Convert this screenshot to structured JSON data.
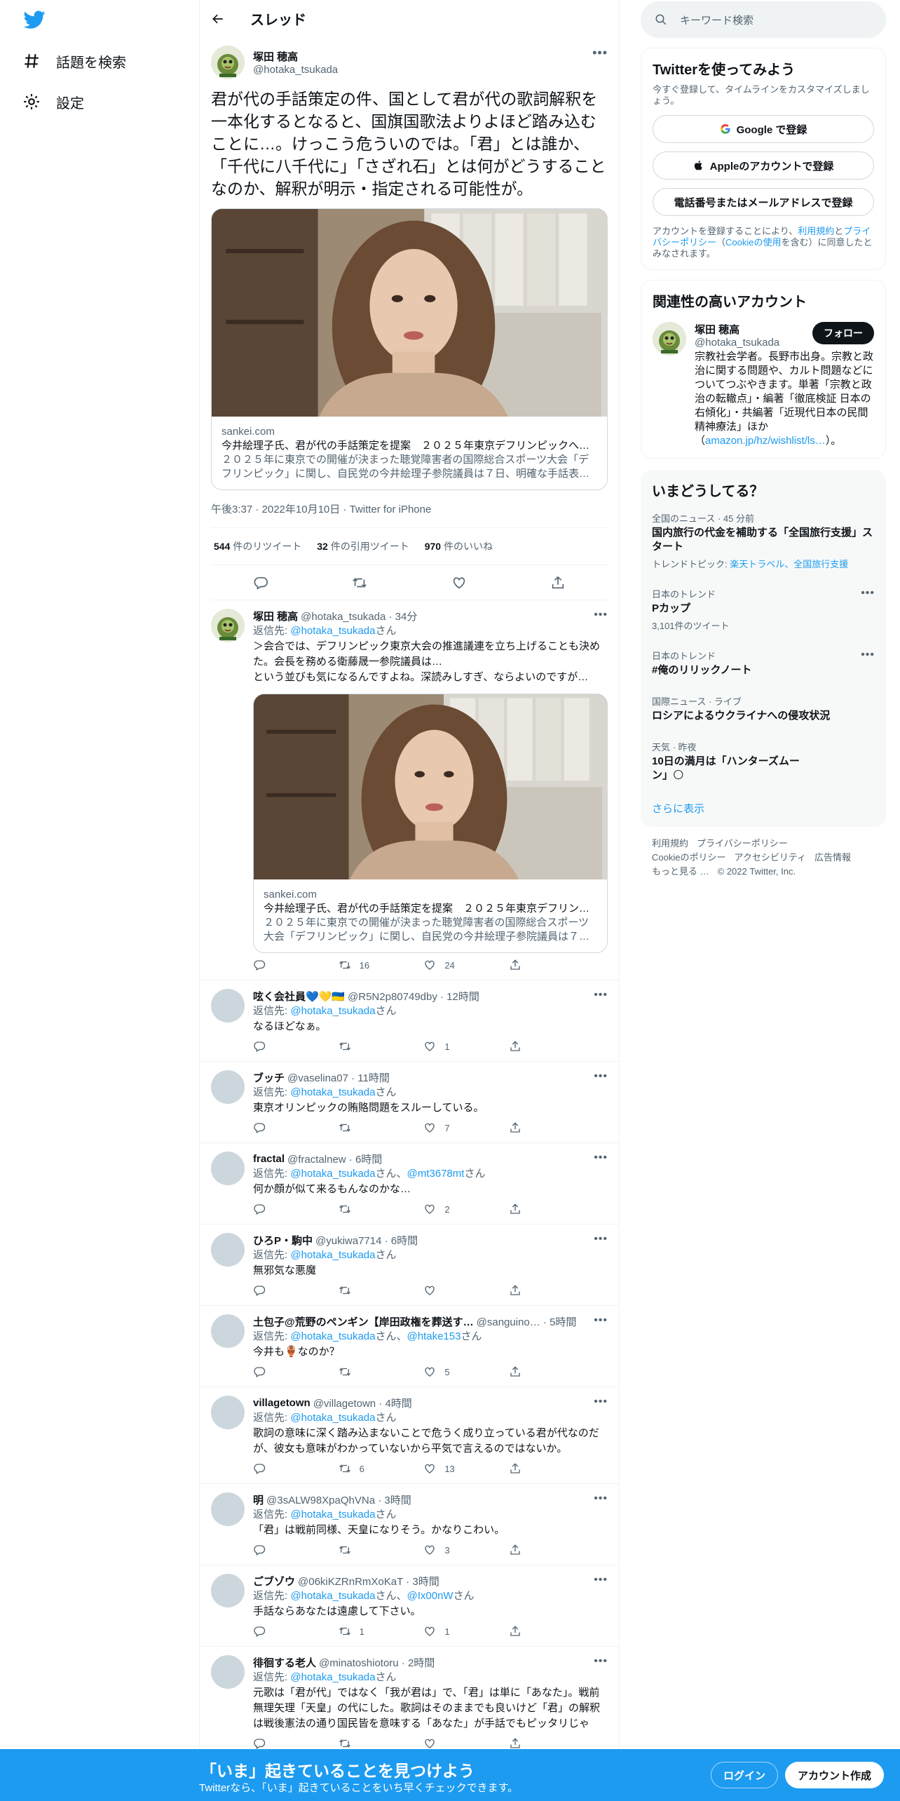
{
  "nav": {
    "explore": "話題を検索",
    "settings": "設定"
  },
  "thread": {
    "title": "スレッド"
  },
  "main_tweet": {
    "name": "塚田 穂高",
    "handle": "@hotaka_tsukada",
    "text": "君が代の手話策定の件、国として君が代の歌詞解釈を一本化するとなると、国旗国歌法よりよほど踏み込むことに…。けっこう危ういのでは。「君」とは誰か、「千代に八千代に」「さざれ石」とは何がどうすることなのか、解釈が明示・指定される可能性が。",
    "card": {
      "domain": "sankei.com",
      "title": "今井絵理子氏、君が代の手話策定を提案　２０２５年東京デフリンピックへ議…",
      "desc": "２０２５年に東京での開催が決まった聴覚障害者の国際総合スポーツ大会「デフリンピック」に関し、自民党の今井絵理子参院議員は７日、明確な手話表現が…"
    },
    "meta": "午後3:37 · 2022年10月10日 · Twitter for iPhone",
    "retweets": "544",
    "retweets_label": "件のリツイート",
    "quotes": "32",
    "quotes_label": "件の引用ツイート",
    "likes": "970",
    "likes_label": "件のいいね"
  },
  "reply_prefix": "返信先: ",
  "replies": [
    {
      "name": "塚田 穂高",
      "handle": "@hotaka_tsukada · 34分",
      "to": "@hotaka_tsukada",
      "to_suffix": "さん",
      "text": "＞会合では、デフリンピック東京大会の推進議連を立ち上げることも決めた。会長を務める衛藤晟一参院議員は…\nという並びも気になるんですよね。深読みしすぎ、ならよいのですが…",
      "card": {
        "domain": "sankei.com",
        "title": "今井絵理子氏、君が代の手話策定を提案　２０２５年東京デフリンピ…",
        "desc": "２０２５年に東京での開催が決まった聴覚障害者の国際総合スポーツ大会「デフリンピック」に関し、自民党の今井絵理子参院議員は７日、…"
      },
      "replies": "",
      "rts": "16",
      "likes": "24"
    },
    {
      "name": "呟く会社員💙💛🇺🇦",
      "handle": "@R5N2p80749dby · 12時間",
      "to": "@hotaka_tsukada",
      "to_suffix": "さん",
      "text": "なるほどなぁ。",
      "replies": "",
      "rts": "",
      "likes": "1"
    },
    {
      "name": "ブッチ",
      "handle": "@vaselina07 · 11時間",
      "to": "@hotaka_tsukada",
      "to_suffix": "さん",
      "text": "東京オリンピックの賄賂問題をスルーしている。",
      "replies": "",
      "rts": "",
      "likes": "7"
    },
    {
      "name": "fractal",
      "handle": "@fractalnew · 6時間",
      "to": "@hotaka_tsukada",
      "to_mid": "さん、",
      "to2": "@mt3678mt",
      "to_suffix": "さん",
      "text": "何か顔が似て来るもんなのかな…",
      "replies": "",
      "rts": "",
      "likes": "2"
    },
    {
      "name": "ひろP・駒中",
      "handle": "@yukiwa7714 · 6時間",
      "to": "@hotaka_tsukada",
      "to_suffix": "さん",
      "text": "無邪気な悪魔",
      "replies": "",
      "rts": "",
      "likes": ""
    },
    {
      "name": "土包子@荒野のペンギン【岸田政権を葬送す…",
      "handle": "@sanguino… · 5時間",
      "to": "@hotaka_tsukada",
      "to_mid": "さん、",
      "to2": "@htake153",
      "to_suffix": "さん",
      "text": "今井も🏺なのか？",
      "replies": "",
      "rts": "",
      "likes": "5"
    },
    {
      "name": "villagetown",
      "handle": "@villagetown · 4時間",
      "to": "@hotaka_tsukada",
      "to_suffix": "さん",
      "text": "歌詞の意味に深く踏み込まないことで危うく成り立っている君が代なのだが、彼女も意味がわかっていないから平気で言えるのではないか。",
      "replies": "",
      "rts": "6",
      "likes": "13"
    },
    {
      "name": "明",
      "handle": "@3sALW98XpaQhVNa · 3時間",
      "to": "@hotaka_tsukada",
      "to_suffix": "さん",
      "text": "「君」は戦前同様、天皇になりそう。かなりこわい。",
      "replies": "",
      "rts": "",
      "likes": "3"
    },
    {
      "name": "ごブゾウ",
      "handle": "@06kiKZRnRmXoKaT · 3時間",
      "to": "@hotaka_tsukada",
      "to_mid": "さん、",
      "to2": "@Ix00nW",
      "to_suffix": "さん",
      "text": "手話ならあなたは遠慮して下さい。",
      "replies": "",
      "rts": "1",
      "likes": "1"
    },
    {
      "name": "徘徊する老人",
      "handle": "@minatoshiotoru · 2時間",
      "to": "@hotaka_tsukada",
      "to_suffix": "さん",
      "text": "元歌は「君が代」ではなく「我が君は」で、「君」は単に「あなた」。戦前無理矢理「天皇」の代にした。歌詞はそのままでも良いけど「君」の解釈は戦後憲法の通り国民皆を意味する「あなた」が手話でもピッタリじゃ",
      "replies": "",
      "rts": "",
      "likes": ""
    }
  ],
  "search": {
    "placeholder": "キーワード検索"
  },
  "signup": {
    "title": "Twitterを使ってみよう",
    "sub": "今すぐ登録して、タイムラインをカスタマイズしましょう。",
    "google": "Google で登録",
    "apple": "Appleのアカウントで登録",
    "phone": "電話番号またはメールアドレスで登録",
    "terms_1": "アカウントを登録することにより、",
    "terms_link1": "利用規約",
    "terms_2": "と",
    "terms_link2": "プライバシーポリシー",
    "terms_3": "（",
    "terms_link3": "Cookieの使用",
    "terms_4": "を含む）に同意したとみなされます。"
  },
  "relevant": {
    "title": "関連性の高いアカウント",
    "name": "塚田 穂高",
    "handle": "@hotaka_tsukada",
    "follow": "フォロー",
    "bio": "宗教社会学者。長野市出身。宗教と政治に関する問題や、カルト問題などについてつぶやきます。単著「宗教と政治の転轍点」・編著「徹底検証 日本の右傾化」・共編著「近現代日本の民間精神療法」ほか（",
    "bio_link": "amazon.jp/hz/wishlist/ls…",
    "bio_end": "）。"
  },
  "trends": {
    "title": "いまどうしてる？",
    "items": [
      {
        "meta": "全国のニュース · 45 分前",
        "title": "国内旅行の代金を補助する「全国旅行支援」スタート",
        "sub_prefix": "トレンドトピック: ",
        "sub_links": "楽天トラベル、全国旅行支援"
      },
      {
        "meta": "日本のトレンド",
        "title": "Pカップ",
        "sub": "3,101件のツイート"
      },
      {
        "meta": "日本のトレンド",
        "title": "#俺のリリックノート"
      },
      {
        "meta": "国際ニュース · ライブ",
        "title": "ロシアによるウクライナへの侵攻状況"
      },
      {
        "meta": "天気 · 昨夜",
        "title": "10日の満月は「ハンターズムーン」🌕"
      }
    ],
    "more": "さらに表示"
  },
  "footer": {
    "l1": "利用規約",
    "l2": "プライバシーポリシー",
    "l3": "Cookieのポリシー",
    "l4": "アクセシビリティ",
    "l5": "広告情報",
    "l6": "もっと見る …",
    "copy": "© 2022 Twitter, Inc."
  },
  "bottom": {
    "title": "「いま」起きていることを見つけよう",
    "sub": "Twitterなら、「いま」起きていることをいち早くチェックできます。",
    "login": "ログイン",
    "signup": "アカウント作成"
  },
  "colors": {
    "accent": "#1d9bf0",
    "text": "#0f1419",
    "muted": "#536471"
  }
}
